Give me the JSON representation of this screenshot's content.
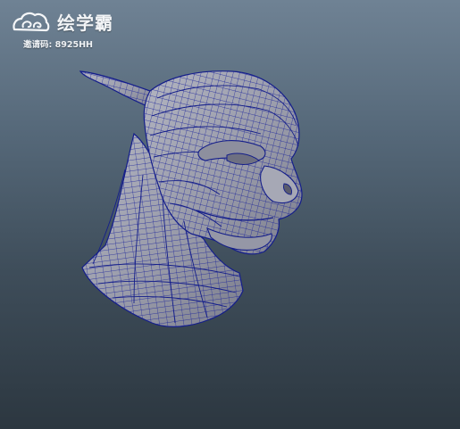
{
  "watermark": {
    "brand_name": "绘学霸",
    "invite_label": "邀请码:",
    "invite_code": "8925HH",
    "logo_icon": "cloud-swirl-logo-icon"
  },
  "viewport": {
    "subject": "wireframe-creature-head-bust",
    "background_top": "#6f8294",
    "background_bottom": "#2c3740",
    "mesh_fill": "#9ea0ad",
    "wire_color": "#141e8a"
  }
}
